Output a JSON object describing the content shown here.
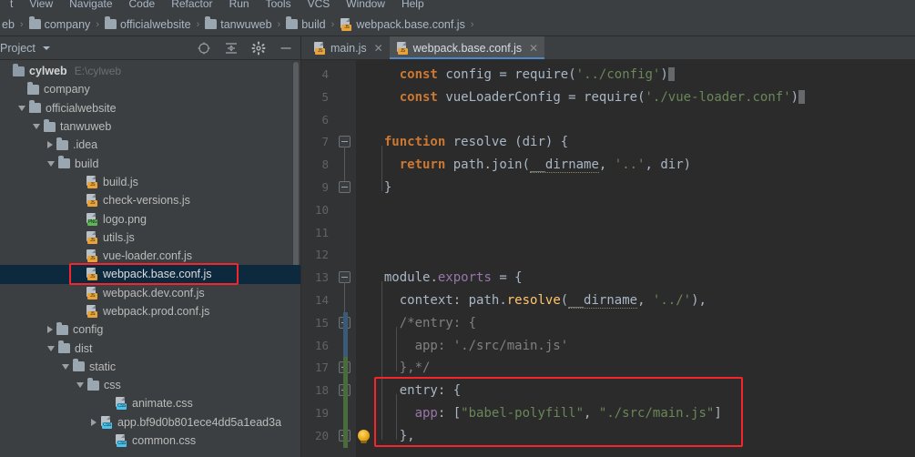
{
  "window": {
    "menubar": [
      "t",
      "View",
      "Navigate",
      "Code",
      "Refactor",
      "Run",
      "Tools",
      "VCS",
      "Window",
      "Help"
    ]
  },
  "breadcrumb": {
    "items": [
      {
        "label": "eb",
        "icon": "none"
      },
      {
        "label": "company",
        "icon": "folder-icon"
      },
      {
        "label": "officialwebsite",
        "icon": "folder-icon"
      },
      {
        "label": "tanwuweb",
        "icon": "folder-icon"
      },
      {
        "label": "build",
        "icon": "folder-icon"
      },
      {
        "label": "webpack.base.conf.js",
        "icon": "js-file-icon"
      }
    ],
    "separator": "›"
  },
  "project_panel": {
    "title": "Project",
    "dropdown_icon": "chevron-down-icon",
    "tools": [
      {
        "name": "locate-icon",
        "label": "Select Opened File"
      },
      {
        "name": "collapse-all-icon",
        "label": "Collapse All"
      },
      {
        "name": "gear-icon",
        "label": "Settings"
      },
      {
        "name": "minimize-icon",
        "label": "Hide"
      }
    ],
    "tree": [
      {
        "label": "cylweb",
        "sub": "E:\\cylweb",
        "icon": "module-icon",
        "arrow": "none",
        "indent": 0,
        "bold": true,
        "selected": false
      },
      {
        "label": "company",
        "sub": "",
        "icon": "folder-icon",
        "arrow": "none",
        "indent": 1,
        "bold": false,
        "selected": false
      },
      {
        "label": "officialwebsite",
        "sub": "",
        "icon": "folder-icon",
        "arrow": "open",
        "indent": 1,
        "bold": false,
        "selected": false
      },
      {
        "label": "tanwuweb",
        "sub": "",
        "icon": "folder-icon",
        "arrow": "open",
        "indent": 2,
        "bold": false,
        "selected": false
      },
      {
        "label": ".idea",
        "sub": "",
        "icon": "folder-icon",
        "arrow": "closed",
        "indent": 3,
        "bold": false,
        "selected": false
      },
      {
        "label": "build",
        "sub": "",
        "icon": "folder-icon",
        "arrow": "open",
        "indent": 3,
        "bold": false,
        "selected": false
      },
      {
        "label": "build.js",
        "sub": "",
        "icon": "js-file-icon",
        "arrow": "none",
        "indent": 5,
        "bold": false,
        "selected": false
      },
      {
        "label": "check-versions.js",
        "sub": "",
        "icon": "js-file-icon",
        "arrow": "none",
        "indent": 5,
        "bold": false,
        "selected": false
      },
      {
        "label": "logo.png",
        "sub": "",
        "icon": "png-file-icon",
        "arrow": "none",
        "indent": 5,
        "bold": false,
        "selected": false
      },
      {
        "label": "utils.js",
        "sub": "",
        "icon": "js-file-icon",
        "arrow": "none",
        "indent": 5,
        "bold": false,
        "selected": false
      },
      {
        "label": "vue-loader.conf.js",
        "sub": "",
        "icon": "js-file-icon",
        "arrow": "none",
        "indent": 5,
        "bold": false,
        "selected": false
      },
      {
        "label": "webpack.base.conf.js",
        "sub": "",
        "icon": "js-file-icon",
        "arrow": "none",
        "indent": 5,
        "bold": false,
        "selected": true
      },
      {
        "label": "webpack.dev.conf.js",
        "sub": "",
        "icon": "js-file-icon",
        "arrow": "none",
        "indent": 5,
        "bold": false,
        "selected": false
      },
      {
        "label": "webpack.prod.conf.js",
        "sub": "",
        "icon": "js-file-icon",
        "arrow": "none",
        "indent": 5,
        "bold": false,
        "selected": false
      },
      {
        "label": "config",
        "sub": "",
        "icon": "folder-icon",
        "arrow": "closed",
        "indent": 3,
        "bold": false,
        "selected": false
      },
      {
        "label": "dist",
        "sub": "",
        "icon": "folder-icon",
        "arrow": "open",
        "indent": 3,
        "bold": false,
        "selected": false
      },
      {
        "label": "static",
        "sub": "",
        "icon": "folder-icon",
        "arrow": "open",
        "indent": 4,
        "bold": false,
        "selected": false
      },
      {
        "label": "css",
        "sub": "",
        "icon": "folder-icon",
        "arrow": "open",
        "indent": 5,
        "bold": false,
        "selected": false
      },
      {
        "label": "animate.css",
        "sub": "",
        "icon": "css-file-icon",
        "arrow": "none",
        "indent": 7,
        "bold": false,
        "selected": false
      },
      {
        "label": "app.bf9d0b801ece4dd5a1ead3a",
        "sub": "",
        "icon": "css-file-icon",
        "arrow": "closed",
        "indent": 6,
        "bold": false,
        "selected": false
      },
      {
        "label": "common.css",
        "sub": "",
        "icon": "css-file-icon",
        "arrow": "none",
        "indent": 7,
        "bold": false,
        "selected": false
      }
    ]
  },
  "editor": {
    "tabs": [
      {
        "label": "main.js",
        "icon": "js-file-icon",
        "active": false,
        "close_icon": "✕"
      },
      {
        "label": "webpack.base.conf.js",
        "icon": "js-file-icon",
        "active": true,
        "close_icon": "✕"
      }
    ],
    "first_line_number": 4,
    "lines": [
      {
        "num": 4,
        "tokens": [
          {
            "t": "    ",
            "c": "punc"
          },
          {
            "t": "const",
            "c": "kw"
          },
          {
            "t": " ",
            "c": "punc"
          },
          {
            "t": "config",
            "c": "id"
          },
          {
            "t": " = ",
            "c": "punc"
          },
          {
            "t": "require",
            "c": "id"
          },
          {
            "t": "(",
            "c": "punc"
          },
          {
            "t": "'../config'",
            "c": "str"
          },
          {
            "t": ")",
            "c": "punc"
          }
        ],
        "caret": true
      },
      {
        "num": 5,
        "tokens": [
          {
            "t": "    ",
            "c": "punc"
          },
          {
            "t": "const",
            "c": "kw"
          },
          {
            "t": " ",
            "c": "punc"
          },
          {
            "t": "vueLoaderConfig",
            "c": "id"
          },
          {
            "t": " = ",
            "c": "punc"
          },
          {
            "t": "require",
            "c": "id"
          },
          {
            "t": "(",
            "c": "punc"
          },
          {
            "t": "'./vue-loader.conf'",
            "c": "str"
          },
          {
            "t": ")",
            "c": "punc"
          }
        ],
        "caret": true
      },
      {
        "num": 6,
        "tokens": [],
        "caret": false
      },
      {
        "num": 7,
        "tokens": [
          {
            "t": "  ",
            "c": "punc"
          },
          {
            "t": "function",
            "c": "kw"
          },
          {
            "t": " ",
            "c": "punc"
          },
          {
            "t": "resolve",
            "c": "id"
          },
          {
            "t": " (",
            "c": "punc"
          },
          {
            "t": "dir",
            "c": "id"
          },
          {
            "t": ") {",
            "c": "punc"
          }
        ],
        "caret": false
      },
      {
        "num": 8,
        "tokens": [
          {
            "t": "    ",
            "c": "punc"
          },
          {
            "t": "return",
            "c": "kw"
          },
          {
            "t": " ",
            "c": "punc"
          },
          {
            "t": "path",
            "c": "id"
          },
          {
            "t": ".",
            "c": "punc"
          },
          {
            "t": "join",
            "c": "id"
          },
          {
            "t": "(",
            "c": "punc"
          },
          {
            "t": "__dirname",
            "c": "dirn"
          },
          {
            "t": ", ",
            "c": "punc"
          },
          {
            "t": "'..'",
            "c": "str"
          },
          {
            "t": ", ",
            "c": "punc"
          },
          {
            "t": "dir",
            "c": "id"
          },
          {
            "t": ")",
            "c": "punc"
          }
        ],
        "caret": false
      },
      {
        "num": 9,
        "tokens": [
          {
            "t": "  }",
            "c": "punc"
          }
        ],
        "caret": false
      },
      {
        "num": 10,
        "tokens": [],
        "caret": false
      },
      {
        "num": 11,
        "tokens": [],
        "caret": false
      },
      {
        "num": 12,
        "tokens": [],
        "caret": false
      },
      {
        "num": 13,
        "tokens": [
          {
            "t": "  ",
            "c": "punc"
          },
          {
            "t": "module",
            "c": "id"
          },
          {
            "t": ".",
            "c": "punc"
          },
          {
            "t": "exports",
            "c": "prop"
          },
          {
            "t": " = {",
            "c": "punc"
          }
        ],
        "caret": false
      },
      {
        "num": 14,
        "tokens": [
          {
            "t": "    ",
            "c": "punc"
          },
          {
            "t": "context",
            "c": "id"
          },
          {
            "t": ": ",
            "c": "punc"
          },
          {
            "t": "path",
            "c": "id"
          },
          {
            "t": ".",
            "c": "punc"
          },
          {
            "t": "resolve",
            "c": "fn"
          },
          {
            "t": "(",
            "c": "punc"
          },
          {
            "t": "__dirname",
            "c": "dirn"
          },
          {
            "t": ", ",
            "c": "punc"
          },
          {
            "t": "'../'",
            "c": "str"
          },
          {
            "t": "),",
            "c": "punc"
          }
        ],
        "caret": false
      },
      {
        "num": 15,
        "tokens": [
          {
            "t": "    /*entry: {",
            "c": "cmt"
          }
        ],
        "caret": false
      },
      {
        "num": 16,
        "tokens": [
          {
            "t": "      app: './src/main.js'",
            "c": "cmt"
          }
        ],
        "caret": false
      },
      {
        "num": 17,
        "tokens": [
          {
            "t": "    },*/",
            "c": "cmt"
          }
        ],
        "caret": false
      },
      {
        "num": 18,
        "tokens": [
          {
            "t": "    ",
            "c": "punc"
          },
          {
            "t": "entry",
            "c": "id"
          },
          {
            "t": ": {",
            "c": "punc"
          }
        ],
        "caret": false
      },
      {
        "num": 19,
        "tokens": [
          {
            "t": "      ",
            "c": "punc"
          },
          {
            "t": "app",
            "c": "prop"
          },
          {
            "t": ": [",
            "c": "punc"
          },
          {
            "t": "\"babel-polyfill\"",
            "c": "str"
          },
          {
            "t": ", ",
            "c": "punc"
          },
          {
            "t": "\"./src/main.js\"",
            "c": "str"
          },
          {
            "t": "]",
            "c": "punc"
          }
        ],
        "caret": false
      },
      {
        "num": 20,
        "tokens": [
          {
            "t": "    },",
            "c": "punc"
          }
        ],
        "caret": false
      }
    ]
  },
  "annotations": {
    "sidebar_box": {
      "label": "highlight-webpack-base-conf-file",
      "color": "#f4262b"
    },
    "code_box": {
      "label": "highlight-entry-block",
      "color": "#f4262b"
    }
  }
}
